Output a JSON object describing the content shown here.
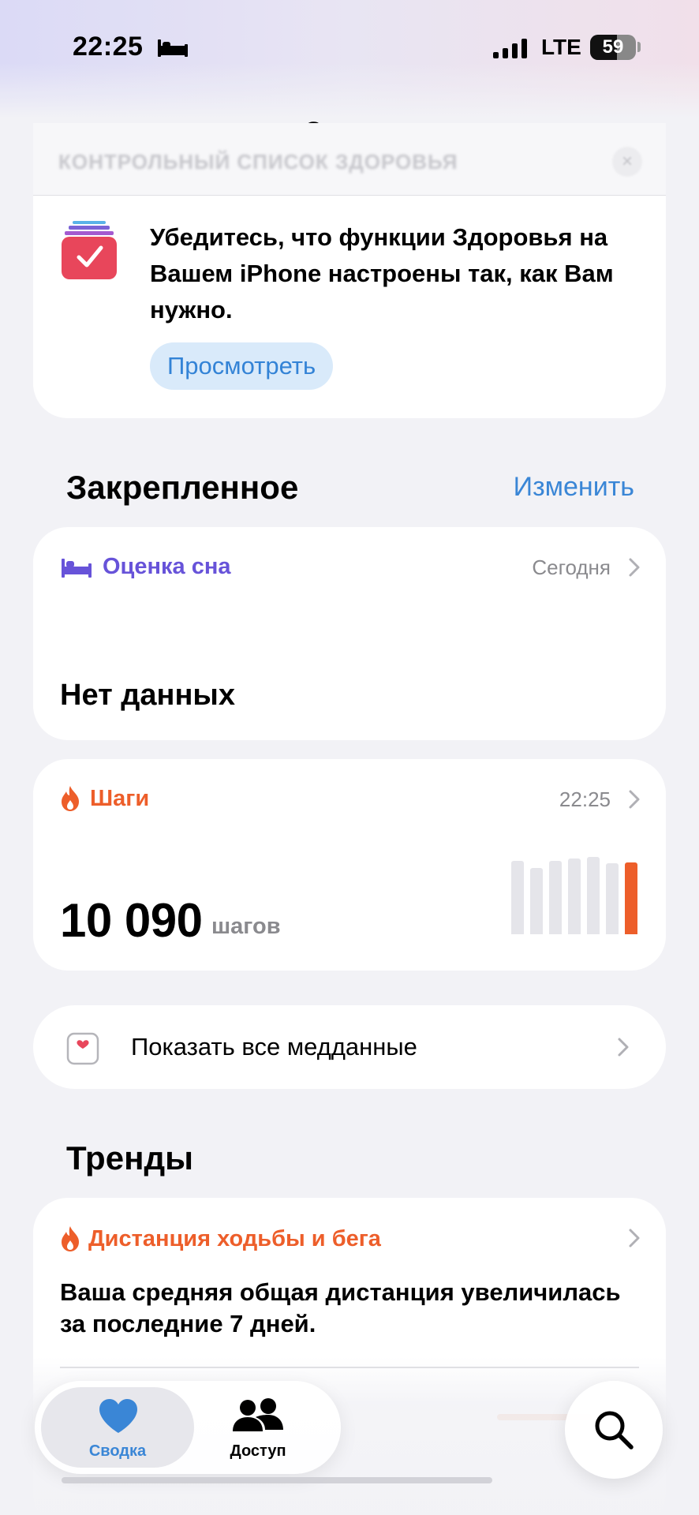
{
  "status_bar": {
    "time": "22:25",
    "network": "LTE",
    "battery": "59",
    "battery_level_percent": 59
  },
  "nav": {
    "title": "Сводка"
  },
  "checklist": {
    "header": "КОНТРОЛЬНЫЙ СПИСОК ЗДОРОВЬЯ",
    "close_glyph": "×",
    "text": "Убедитесь, что функции Здоровья на Вашем iPhone настроены так, как Вам нужно.",
    "button": "Просмотреть"
  },
  "pinned": {
    "title": "Закрепленное",
    "edit": "Изменить",
    "sleep": {
      "label": "Оценка сна",
      "date": "Сегодня",
      "value": "Нет данных",
      "color": "#6753d9"
    },
    "steps": {
      "label": "Шаги",
      "time": "22:25",
      "value": "10 090",
      "unit": "шагов",
      "color": "#ed5e2a",
      "bar_levels": [
        1.0,
        0.9,
        1.0,
        1.03,
        1.05,
        0.96,
        0.98
      ]
    }
  },
  "all_data": {
    "label": "Показать все медданные"
  },
  "trends": {
    "title": "Тренды",
    "item_label": "Дистанция ходьбы и бега",
    "item_text": "Ваша средняя общая дистанция увеличилась за последние 7 дней."
  },
  "tabbar": {
    "tabs": [
      {
        "label": "Сводка",
        "icon": "heart-icon",
        "active": true,
        "color": "#3a86d6"
      },
      {
        "label": "Доступ",
        "icon": "people-icon",
        "active": false,
        "color": "#000000"
      }
    ],
    "search_icon": "search-icon"
  }
}
